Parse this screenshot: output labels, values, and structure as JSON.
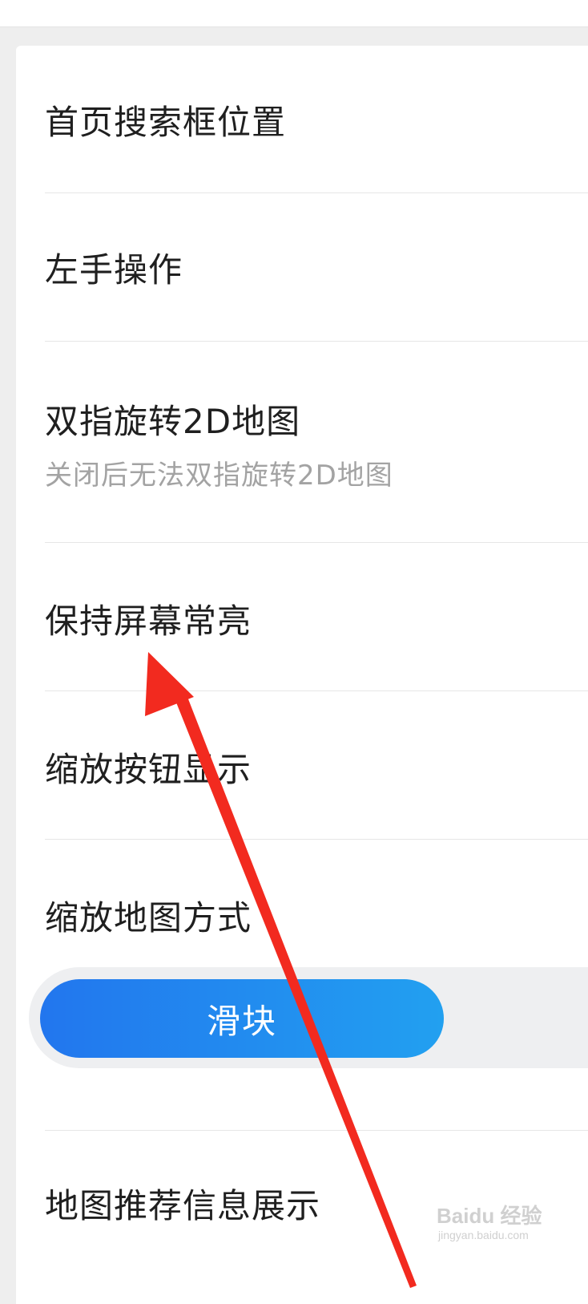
{
  "settings": {
    "items": [
      {
        "title": "首页搜索框位置"
      },
      {
        "title": "左手操作"
      },
      {
        "title": "双指旋转2D地图",
        "subtitle": "关闭后无法双指旋转2D地图"
      },
      {
        "title": "保持屏幕常亮"
      },
      {
        "title": "缩放按钮显示"
      },
      {
        "title": "缩放地图方式"
      },
      {
        "title": "地图推荐信息展示"
      }
    ],
    "zoom_mode": {
      "selected_label": "滑块"
    }
  },
  "watermark": {
    "brand": "Baidu 经验",
    "domain": "jingyan.baidu.com"
  },
  "colors": {
    "accent_start": "#2276ee",
    "accent_end": "#22a0f0",
    "annotation_arrow": "#f22a1f"
  }
}
